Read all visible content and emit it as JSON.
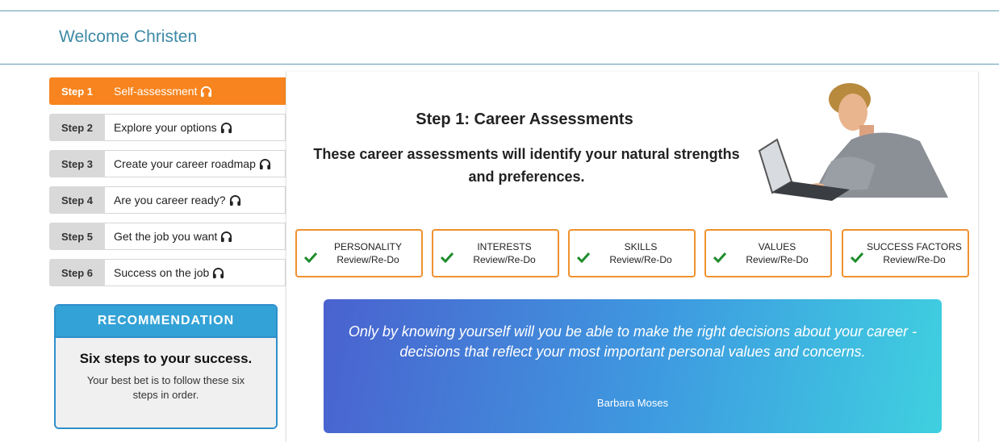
{
  "header": {
    "welcome": "Welcome Christen"
  },
  "steps": [
    {
      "num": "Step 1",
      "label": "Self-assessment",
      "active": true
    },
    {
      "num": "Step 2",
      "label": "Explore your options",
      "active": false
    },
    {
      "num": "Step 3",
      "label": "Create your career roadmap",
      "active": false
    },
    {
      "num": "Step 4",
      "label": "Are you career ready?",
      "active": false
    },
    {
      "num": "Step 5",
      "label": "Get the job you want",
      "active": false
    },
    {
      "num": "Step 6",
      "label": "Success on the job",
      "active": false
    }
  ],
  "recommendation": {
    "heading": "RECOMMENDATION",
    "title": "Six steps to your success.",
    "text": "Your best bet is to follow these six steps in order."
  },
  "main": {
    "title": "Step 1: Career Assessments",
    "subtitle": "These career assessments will identify your natural strengths and preferences.",
    "assessments": [
      {
        "name": "PERSONALITY",
        "action": "Review/Re-Do",
        "done": true
      },
      {
        "name": "INTERESTS",
        "action": "Review/Re-Do",
        "done": true
      },
      {
        "name": "SKILLS",
        "action": "Review/Re-Do",
        "done": true
      },
      {
        "name": "VALUES",
        "action": "Review/Re-Do",
        "done": true
      },
      {
        "name": "SUCCESS FACTORS",
        "action": "Review/Re-Do",
        "done": true
      }
    ],
    "quote": {
      "text": "Only by knowing yourself will you be able to make the right decisions about your career - decisions that reflect your most important personal values and concerns.",
      "author": "Barbara Moses"
    }
  },
  "colors": {
    "accent": "#f7841e",
    "header_text": "#3d8aa6",
    "rec_blue": "#33a2d6",
    "check_green": "#1e8c2c"
  },
  "icons": {
    "step_icon": "headphones-icon",
    "card_icon": "checkmark-icon"
  }
}
